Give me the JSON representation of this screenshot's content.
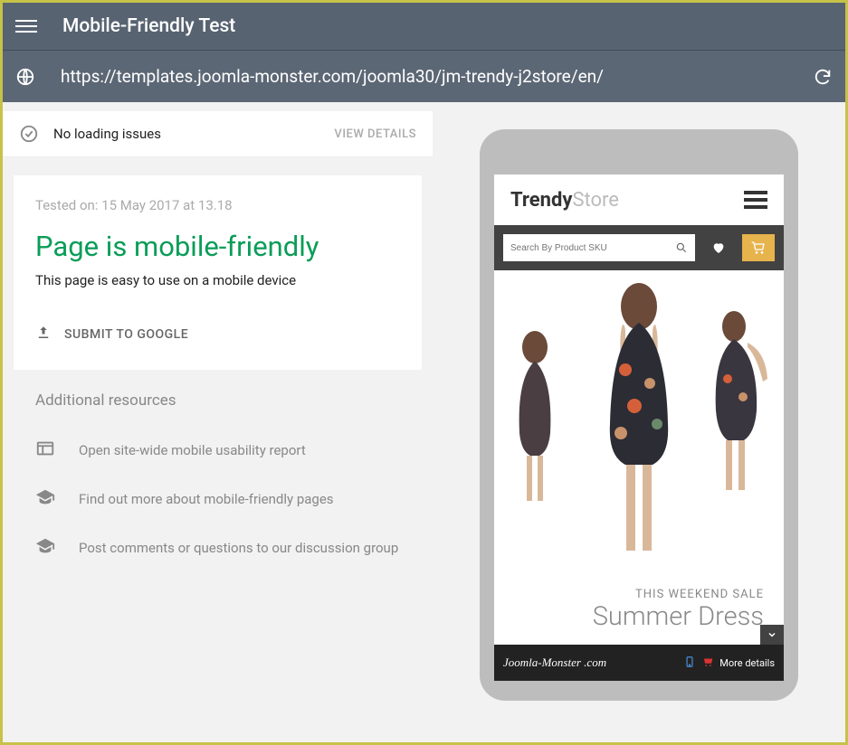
{
  "header": {
    "title": "Mobile-Friendly Test"
  },
  "urlbar": {
    "url": "https://templates.joomla-monster.com/joomla30/jm-trendy-j2store/en/"
  },
  "status": {
    "text": "No loading issues",
    "view_details": "VIEW DETAILS"
  },
  "result": {
    "tested_on": "Tested on: 15 May 2017 at 13.18",
    "headline": "Page is mobile-friendly",
    "subhead": "This page is easy to use on a mobile device",
    "submit": "SUBMIT TO GOOGLE"
  },
  "resources": {
    "title": "Additional resources",
    "items": [
      "Open site-wide mobile usability report",
      "Find out more about mobile-friendly pages",
      "Post comments or questions to our discussion group"
    ]
  },
  "preview": {
    "brand_bold": "Trendy",
    "brand_light": "Store",
    "search_placeholder": "Search By Product SKU",
    "sale_label": "THIS WEEKEND SALE",
    "product": "Summer Dress",
    "footer_brand": "Joomla-Monster .com",
    "footer_more": "More details"
  }
}
